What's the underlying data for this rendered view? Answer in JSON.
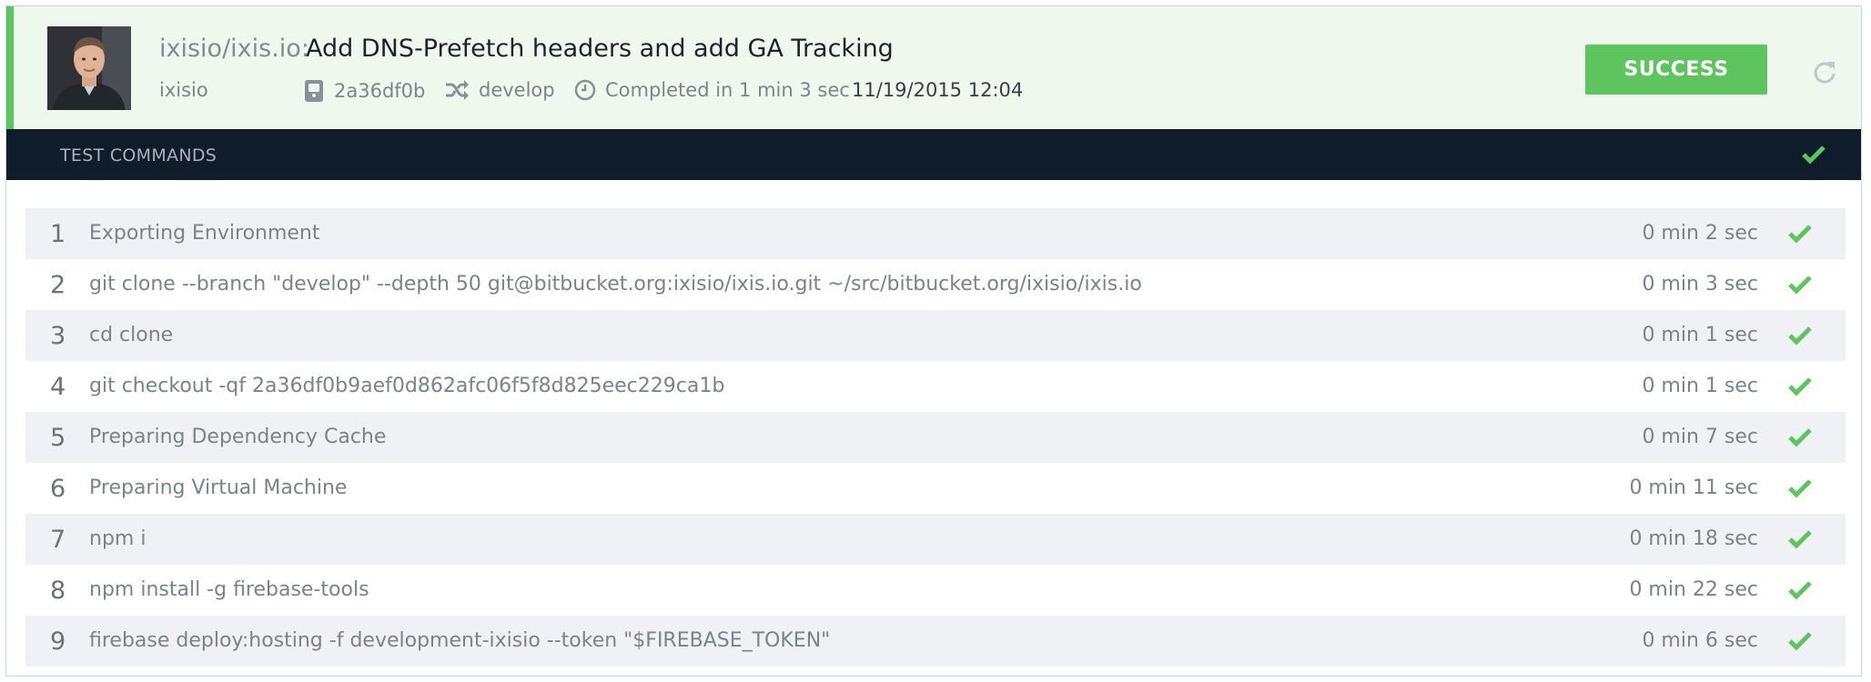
{
  "header": {
    "repo": "ixisio/ixis.io:",
    "title": "Add DNS-Prefetch headers and add GA Tracking",
    "author": "ixisio",
    "commit": "2a36df0b",
    "branch": "develop",
    "duration": "Completed in 1 min 3 sec",
    "date": "11/19/2015 12:04",
    "status": "SUCCESS",
    "status_color": "#5ec45e"
  },
  "section": {
    "title": "TEST COMMANDS"
  },
  "commands": [
    {
      "num": "1",
      "cmd": "Exporting Environment",
      "dur": "0 min 2 sec"
    },
    {
      "num": "2",
      "cmd": "git clone --branch \"develop\" --depth 50 git@bitbucket.org:ixisio/ixis.io.git ~/src/bitbucket.org/ixisio/ixis.io",
      "dur": "0 min 3 sec"
    },
    {
      "num": "3",
      "cmd": "cd clone",
      "dur": "0 min 1 sec"
    },
    {
      "num": "4",
      "cmd": "git checkout -qf 2a36df0b9aef0d862afc06f5f8d825eec229ca1b",
      "dur": "0 min 1 sec"
    },
    {
      "num": "5",
      "cmd": "Preparing Dependency Cache",
      "dur": "0 min 7 sec"
    },
    {
      "num": "6",
      "cmd": "Preparing Virtual Machine",
      "dur": "0 min 11 sec"
    },
    {
      "num": "7",
      "cmd": "npm i",
      "dur": "0 min 18 sec"
    },
    {
      "num": "8",
      "cmd": "npm install -g firebase-tools",
      "dur": "0 min 22 sec"
    },
    {
      "num": "9",
      "cmd": "firebase deploy:hosting -f development-ixisio --token \"$FIREBASE_TOKEN\"",
      "dur": "0 min 6 sec"
    }
  ],
  "icons": {
    "commit": "git-commit-icon",
    "branch": "shuffle-branch-icon",
    "clock": "clock-icon",
    "refresh": "refresh-icon",
    "check": "check-icon"
  }
}
